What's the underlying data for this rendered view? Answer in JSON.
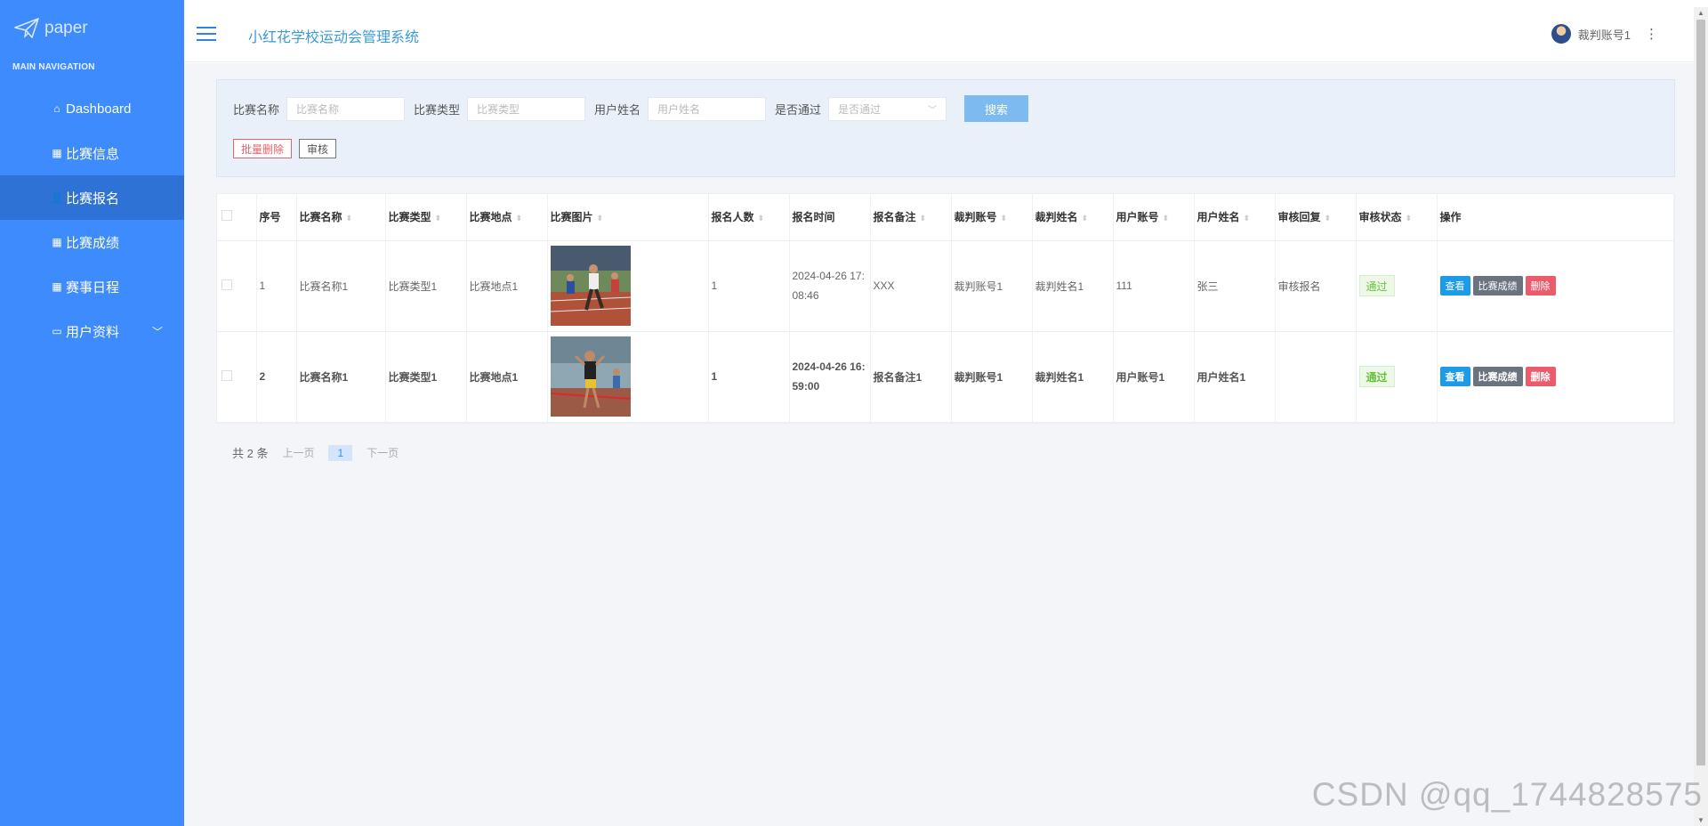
{
  "brand": {
    "logo_text": "paper",
    "nav_heading": "MAIN NAVIGATION"
  },
  "sidebar": {
    "items": [
      {
        "label": "Dashboard",
        "icon": "home-icon"
      },
      {
        "label": "比赛信息",
        "icon": "grid-icon"
      },
      {
        "label": "比赛报名",
        "icon": "user-icon",
        "active": true
      },
      {
        "label": "比赛成绩",
        "icon": "grid-icon"
      },
      {
        "label": "赛事日程",
        "icon": "grid-icon"
      },
      {
        "label": "用户资料",
        "icon": "card-icon",
        "has_submenu": true
      }
    ]
  },
  "header": {
    "title": "小红花学校运动会管理系统",
    "user_name": "裁判账号1"
  },
  "filters": {
    "match_name": {
      "label": "比赛名称",
      "placeholder": "比赛名称"
    },
    "match_type": {
      "label": "比赛类型",
      "placeholder": "比赛类型"
    },
    "user_name": {
      "label": "用户姓名",
      "placeholder": "用户姓名"
    },
    "passed": {
      "label": "是否通过",
      "placeholder": "是否通过"
    },
    "search_label": "搜索",
    "batch_delete_label": "批量删除",
    "review_label": "审核"
  },
  "table": {
    "headers": [
      "序号",
      "比赛名称",
      "比赛类型",
      "比赛地点",
      "比赛图片",
      "报名人数",
      "报名时间",
      "报名备注",
      "裁判账号",
      "裁判姓名",
      "用户账号",
      "用户姓名",
      "审核回复",
      "审核状态",
      "操作"
    ],
    "rows": [
      {
        "index": "1",
        "match_name": "比赛名称1",
        "match_type": "比赛类型1",
        "location": "比赛地点1",
        "count": "1",
        "time": "2024-04-26 17:08:46",
        "note": "XXX",
        "judge_account": "裁判账号1",
        "judge_name": "裁判姓名1",
        "user_account": "111",
        "user_name": "张三",
        "reply": "审核报名",
        "status": "通过"
      },
      {
        "index": "2",
        "match_name": "比赛名称1",
        "match_type": "比赛类型1",
        "location": "比赛地点1",
        "count": "1",
        "time": "2024-04-26 16:59:00",
        "note": "报名备注1",
        "judge_account": "裁判账号1",
        "judge_name": "裁判姓名1",
        "user_account": "用户账号1",
        "user_name": "用户姓名1",
        "reply": "",
        "status": "通过"
      }
    ],
    "actions": {
      "view": "查看",
      "score": "比赛成绩",
      "delete": "删除"
    }
  },
  "pagination": {
    "total": "共 2 条",
    "prev": "上一页",
    "current": "1",
    "next": "下一页"
  },
  "watermark": "CSDN @qq_1744828575",
  "colors": {
    "sidebar": "#3d8bfd",
    "active_item": "#2f72d6",
    "title": "#3a9bd5",
    "view_btn": "#1e9be8",
    "delete_btn": "#ec5b6b"
  }
}
